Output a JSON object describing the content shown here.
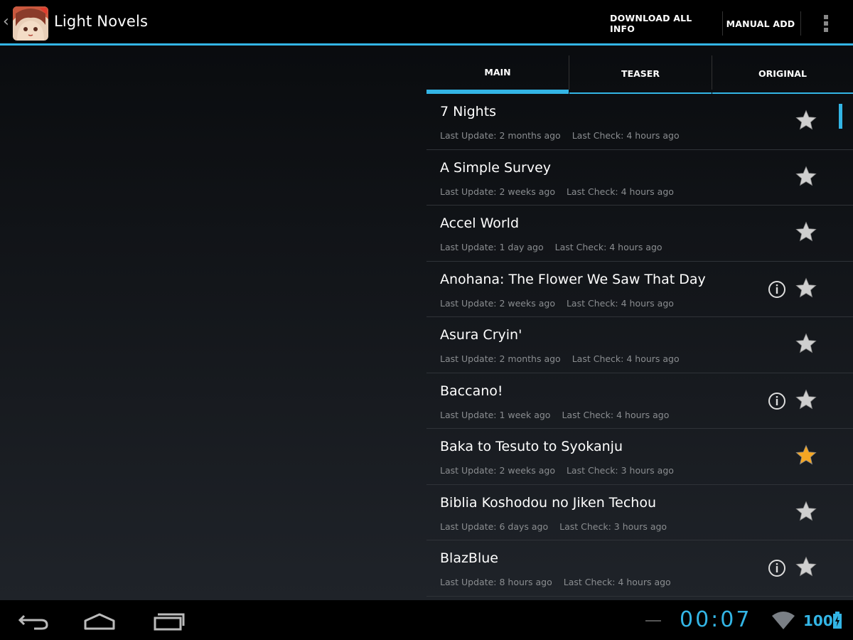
{
  "actionbar": {
    "title": "Light Novels",
    "actions": [
      "DOWNLOAD ALL INFO",
      "MANUAL ADD"
    ]
  },
  "tabs": [
    {
      "label": "MAIN",
      "selected": true
    },
    {
      "label": "TEASER",
      "selected": false
    },
    {
      "label": "ORIGINAL",
      "selected": false
    }
  ],
  "novels": [
    {
      "title": "7 Nights",
      "last_update": "Last Update: 2 months ago",
      "last_check": "Last Check: 4 hours ago",
      "info": false,
      "starred": false
    },
    {
      "title": "A Simple Survey",
      "last_update": "Last Update: 2 weeks ago",
      "last_check": "Last Check: 4 hours ago",
      "info": false,
      "starred": false
    },
    {
      "title": "Accel World",
      "last_update": "Last Update: 1 day ago",
      "last_check": "Last Check: 4 hours ago",
      "info": false,
      "starred": false
    },
    {
      "title": "Anohana: The Flower We Saw That Day",
      "last_update": "Last Update: 2 weeks ago",
      "last_check": "Last Check: 4 hours ago",
      "info": true,
      "starred": false
    },
    {
      "title": "Asura Cryin'",
      "last_update": "Last Update: 2 months ago",
      "last_check": "Last Check: 4 hours ago",
      "info": false,
      "starred": false
    },
    {
      "title": "Baccano!",
      "last_update": "Last Update: 1 week ago",
      "last_check": "Last Check: 4 hours ago",
      "info": true,
      "starred": false
    },
    {
      "title": "Baka to Tesuto to Syokanju",
      "last_update": "Last Update: 2 weeks ago",
      "last_check": "Last Check: 3 hours ago",
      "info": false,
      "starred": true
    },
    {
      "title": "Biblia Koshodou no Jiken Techou",
      "last_update": "Last Update: 6 days ago",
      "last_check": "Last Check: 3 hours ago",
      "info": false,
      "starred": false
    },
    {
      "title": "BlazBlue",
      "last_update": "Last Update: 8 hours ago",
      "last_check": "Last Check: 4 hours ago",
      "info": true,
      "starred": false
    }
  ],
  "status": {
    "clock": "00:07",
    "battery": "100"
  },
  "colors": {
    "accent": "#33b5e5",
    "star_off": "#cfcfcf",
    "star_on": "#f5a623"
  },
  "icons": {
    "nav": [
      "back-icon",
      "home-icon",
      "recent-apps-icon"
    ],
    "row": [
      "info-icon",
      "star-icon"
    ],
    "status": [
      "wifi-icon",
      "battery-icon"
    ]
  }
}
